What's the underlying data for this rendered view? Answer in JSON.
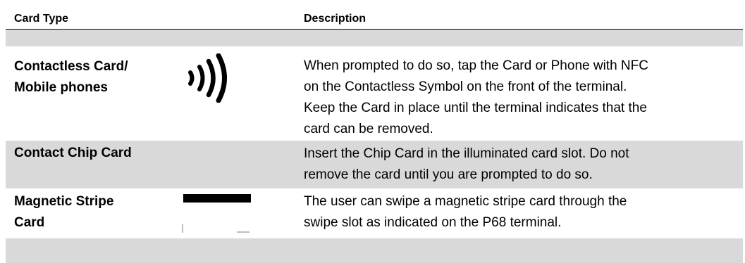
{
  "table": {
    "headers": {
      "card_type": "Card Type",
      "description": "Description"
    },
    "rows": [
      {
        "type_lines": [
          "Contactless Card/",
          "Mobile phones"
        ],
        "icon": "contactless-icon",
        "description_lines": [
          "When prompted to do so, tap the Card or Phone with NFC",
          "on the Contactless Symbol on the front of the terminal.",
          "Keep the Card in place until the terminal indicates that the",
          "card can be removed."
        ]
      },
      {
        "type_lines": [
          "Contact Chip Card"
        ],
        "icon": "",
        "description_lines": [
          "Insert the Chip Card in the illuminated card slot. Do not",
          "remove the card until you are prompted to do so."
        ]
      },
      {
        "type_lines": [
          "Magnetic Stripe",
          "Card"
        ],
        "icon": "magnetic-stripe-card-icon",
        "description_lines": [
          "The user can swipe a magnetic stripe card through the",
          "swipe slot as indicated on the P68 terminal."
        ]
      }
    ]
  },
  "colors": {
    "shade": "#d9d9d9",
    "rule": "#000000"
  }
}
